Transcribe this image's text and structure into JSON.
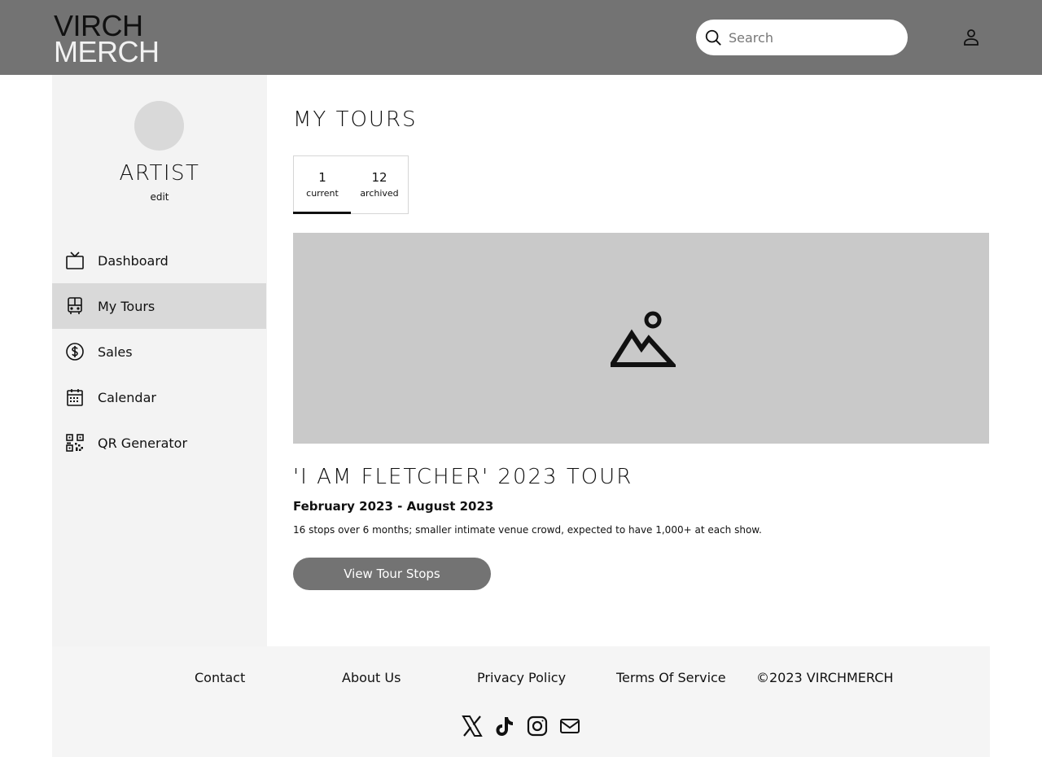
{
  "header": {
    "logo_line1": "VIRCH",
    "logo_line2": "MERCH",
    "search_placeholder": "Search"
  },
  "sidebar": {
    "artist_name": "ARTIST",
    "edit_label": "edit",
    "items": [
      {
        "label": "Dashboard",
        "icon": "tv-icon"
      },
      {
        "label": "My Tours",
        "icon": "bus-icon",
        "active": true
      },
      {
        "label": "Sales",
        "icon": "dollar-circle-icon"
      },
      {
        "label": "Calendar",
        "icon": "calendar-icon"
      },
      {
        "label": "QR Generator",
        "icon": "qr-code-icon"
      }
    ]
  },
  "main": {
    "title": "MY TOURS",
    "tabs": [
      {
        "count": "1",
        "label": "current",
        "active": true
      },
      {
        "count": "12",
        "label": "archived"
      }
    ],
    "tour": {
      "image_icon": "image-placeholder-icon",
      "title": "'I AM FLETCHER' 2023 TOUR",
      "dates": "February 2023 - August 2023",
      "description": "16 stops over 6 months; smaller intimate venue crowd, expected to have 1,000+ at each show.",
      "button_label": "View Tour Stops"
    }
  },
  "footer": {
    "links": [
      "Contact",
      "About Us",
      "Privacy Policy",
      "Terms Of Service"
    ],
    "copyright": "©2023 VIRCHMERCH",
    "social_icons": [
      "x-icon",
      "tiktok-icon",
      "instagram-icon",
      "mail-icon"
    ]
  },
  "colors": {
    "header_bg": "#737373",
    "sidebar_bg": "#f3f3f3",
    "active_nav_bg": "#d9d9d9",
    "image_placeholder_bg": "#c9c9c9",
    "button_bg": "#737373"
  }
}
